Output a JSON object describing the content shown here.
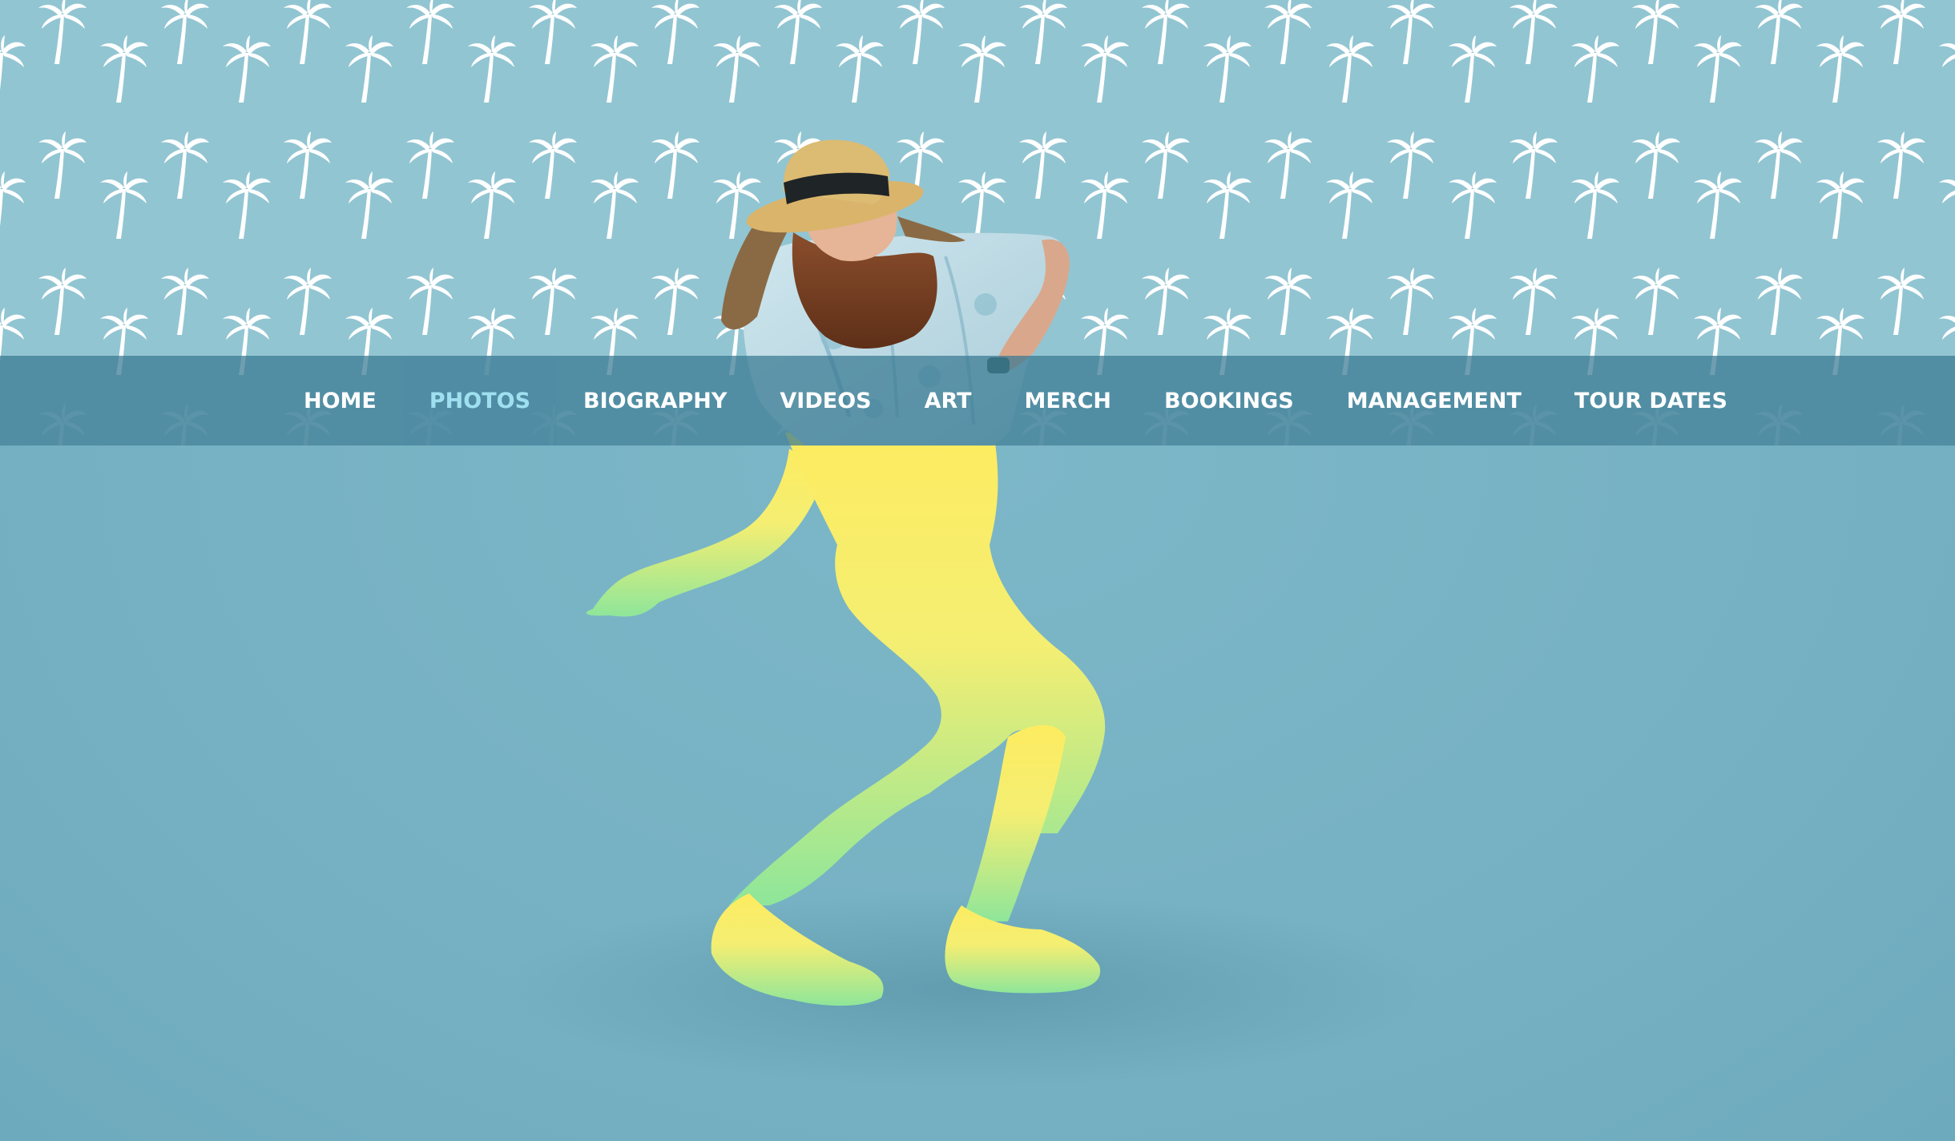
{
  "nav": {
    "items": [
      {
        "label": "HOME",
        "active": false
      },
      {
        "label": "PHOTOS",
        "active": true
      },
      {
        "label": "BIOGRAPHY",
        "active": false
      },
      {
        "label": "VIDEOS",
        "active": false
      },
      {
        "label": "ART",
        "active": false
      },
      {
        "label": "MERCH",
        "active": false
      },
      {
        "label": "BOOKINGS",
        "active": false
      },
      {
        "label": "MANAGEMENT",
        "active": false
      },
      {
        "label": "TOUR DATES",
        "active": false
      }
    ]
  },
  "theme": {
    "background": "#78b3c5",
    "pattern_background": "#92c5d2",
    "pattern_icon": "palm-tree-icon",
    "nav_background": "#387891",
    "nav_text": "#ffffff",
    "nav_active_text": "#9fe0f0",
    "figure_gradient_top": "#fdec61",
    "figure_gradient_bottom": "#8ee69a"
  }
}
